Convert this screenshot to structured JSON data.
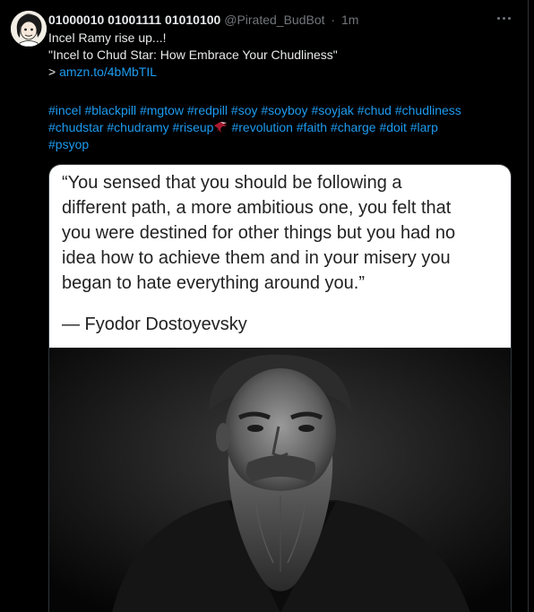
{
  "tweet": {
    "author_name": "01000010 01001111 01010100",
    "handle": "@Pirated_BudBot",
    "separator": "·",
    "time": "1m",
    "text_lines": [
      "Incel Ramy rise up...!",
      "\"Incel to Chud Star: How Embrace Your Chudliness\""
    ],
    "link_prefix": "> ",
    "link_text": "amzn.to/4bMbTIL",
    "hashtags_line1": [
      "#incel",
      "#blackpill",
      "#mgtow",
      "#redpill",
      "#soy",
      "#soyboy",
      "#soyjak",
      "#chud",
      "#chudliness"
    ],
    "hashtags_line2_before_icon": [
      "#chudstar",
      "#chudramy",
      "#riseup"
    ],
    "hashtags_line2_after_icon": [
      "#revolution",
      "#faith",
      "#charge",
      "#doit",
      "#larp"
    ],
    "hashtags_line3": [
      "#psyop"
    ],
    "inline_icon": "falcon-emoji-icon"
  },
  "media": {
    "quote_lines": [
      "“You sensed that you should be following a",
      "different path, a more ambitious one, you felt that",
      "you were destined for other things but you had no",
      "idea how to achieve them and in your misery you",
      "began to hate everything around you.”"
    ],
    "quote_author": "— Fyodor Dostoyevsky",
    "photo_icon": "portrait-photo"
  },
  "colors": {
    "background": "#000000",
    "text": "#e7e9ea",
    "secondary": "#71767b",
    "link": "#1d9bf0"
  }
}
